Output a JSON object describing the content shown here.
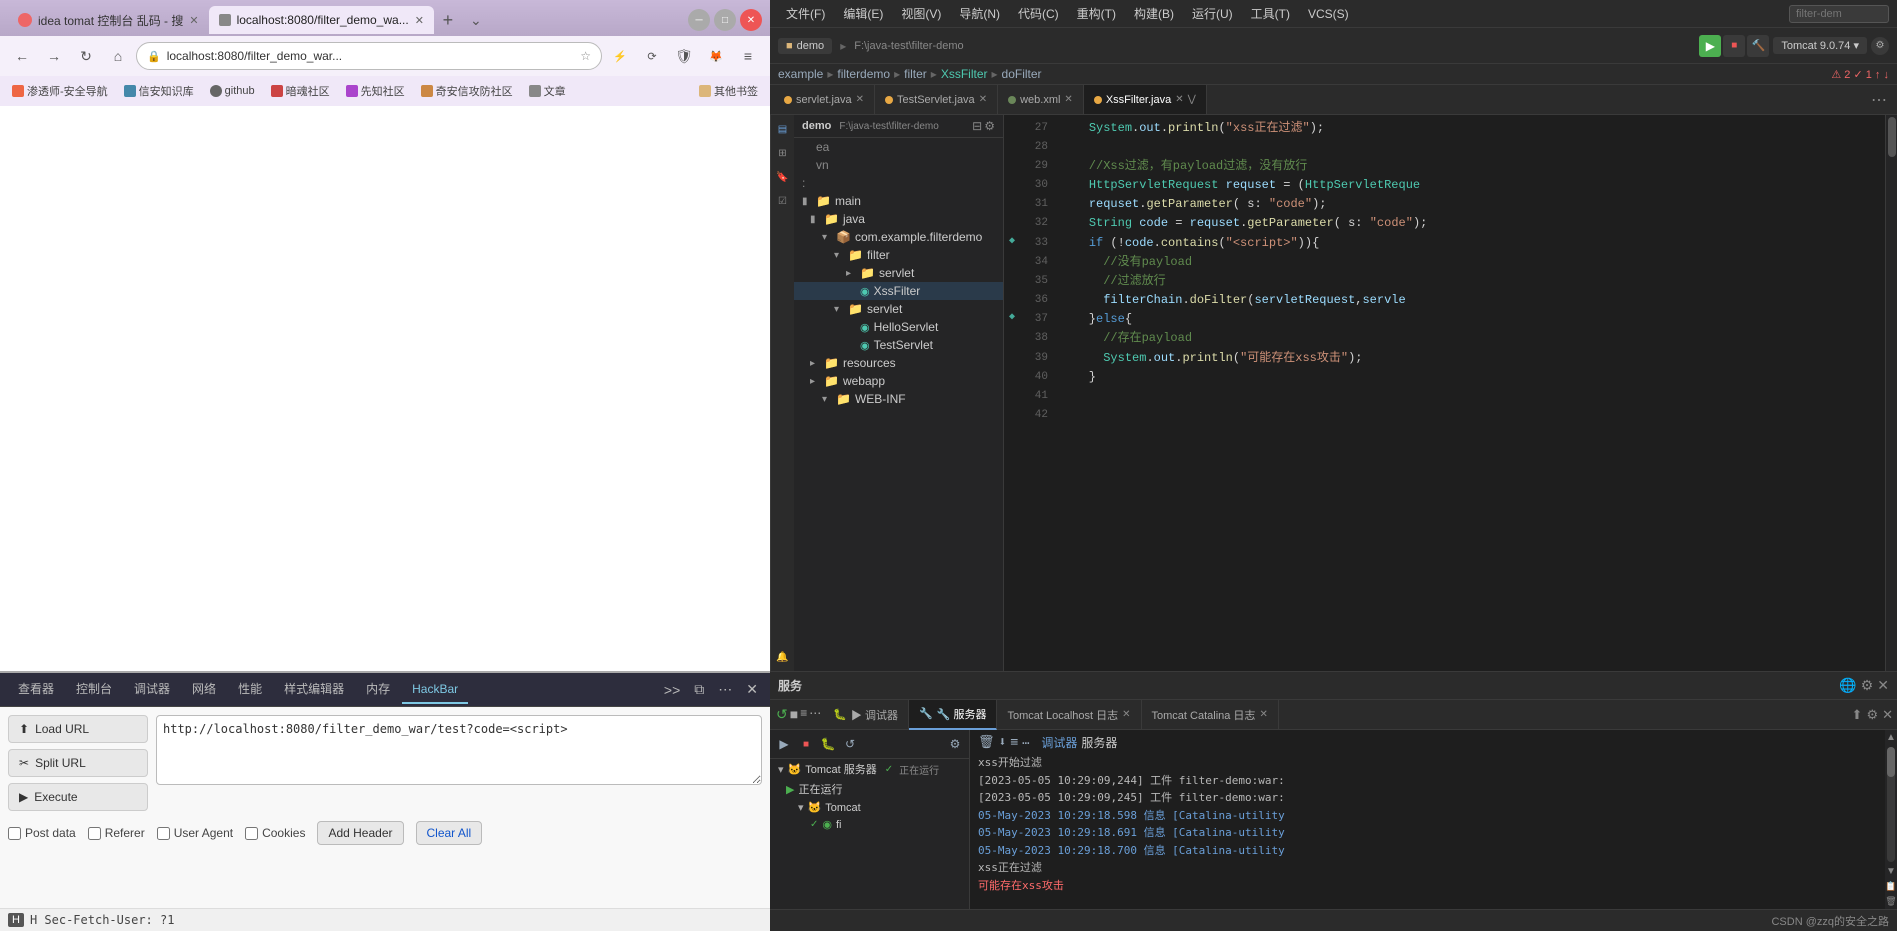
{
  "browser": {
    "tabs": [
      {
        "id": "tab1",
        "label": "idea tomat 控制台 乱码 - 搜",
        "active": false
      },
      {
        "id": "tab2",
        "label": "localhost:8080/filter_demo_wa...",
        "active": true
      }
    ],
    "url": "localhost:8080/filter_demo_war...",
    "bookmarks": [
      {
        "label": "渗透师-安全导航"
      },
      {
        "label": "信安知识库"
      },
      {
        "label": "github"
      },
      {
        "label": "暗魂社区"
      },
      {
        "label": "先知社区"
      },
      {
        "label": "奇安信攻防社区"
      },
      {
        "label": "文章"
      },
      {
        "label": "其他书签"
      }
    ]
  },
  "devtools": {
    "tabs": [
      {
        "label": "查看器"
      },
      {
        "label": "控制台"
      },
      {
        "label": "调试器"
      },
      {
        "label": "网络"
      },
      {
        "label": "性能"
      },
      {
        "label": "样式编辑器"
      },
      {
        "label": "内存"
      },
      {
        "label": "HackBar",
        "active": true
      }
    ]
  },
  "hackbar": {
    "load_url_label": "Load URL",
    "split_url_label": "Split URL",
    "execute_label": "Execute",
    "url_value": "http://localhost:8080/filter_demo_war/test?code=<script>",
    "url_placeholder": "http://localhost:8080/filter_demo_war/test?code=<script>",
    "post_data_label": "Post data",
    "referer_label": "Referer",
    "user_agent_label": "User Agent",
    "cookies_label": "Cookies",
    "add_header_label": "Add Header",
    "clear_all_label": "Clear All",
    "status_bar_text": "H   Sec-Fetch-User: ?1"
  },
  "ide": {
    "menubar": [
      "文件(F)",
      "编辑(E)",
      "视图(V)",
      "导航(N)",
      "代码(C)",
      "重构(T)",
      "构建(B)",
      "运行(U)",
      "工具(T)",
      "VCS(S)"
    ],
    "search_placeholder": "filter-dem",
    "breadcrumb": [
      "example",
      "filterdemo",
      "filter",
      "XssFilter",
      "doFilter"
    ],
    "tabs": [
      {
        "label": "servlet.java",
        "active": false,
        "type": "java"
      },
      {
        "label": "TestServlet.java",
        "active": false,
        "type": "java"
      },
      {
        "label": "web.xml",
        "active": false,
        "type": "xml"
      },
      {
        "label": "XssFilter.java",
        "active": true,
        "type": "java"
      }
    ],
    "project_label": "demo",
    "project_path": "F:\\java-test\\filter-demo",
    "file_tree": [
      {
        "label": "ea",
        "indent": 0,
        "type": "item"
      },
      {
        "label": "vn",
        "indent": 0,
        "type": "item"
      },
      {
        "label": ":",
        "indent": 0,
        "type": "item"
      },
      {
        "label": "main",
        "indent": 0,
        "type": "folder",
        "expanded": true
      },
      {
        "label": "java",
        "indent": 1,
        "type": "folder",
        "expanded": true
      },
      {
        "label": "com.example.filterdemo",
        "indent": 2,
        "type": "folder",
        "expanded": true
      },
      {
        "label": "filter",
        "indent": 3,
        "type": "folder",
        "expanded": true
      },
      {
        "label": "servlet",
        "indent": 4,
        "type": "folder"
      },
      {
        "label": "XssFilter",
        "indent": 4,
        "type": "java"
      },
      {
        "label": "servlet",
        "indent": 3,
        "type": "folder",
        "expanded": true
      },
      {
        "label": "HelloServlet",
        "indent": 4,
        "type": "java"
      },
      {
        "label": "TestServlet",
        "indent": 4,
        "type": "java"
      },
      {
        "label": "resources",
        "indent": 1,
        "type": "folder"
      },
      {
        "label": "webapp",
        "indent": 1,
        "type": "folder"
      },
      {
        "label": "WEB-INF",
        "indent": 2,
        "type": "folder",
        "expanded": false
      }
    ],
    "code_lines": [
      {
        "num": 27,
        "content": "    System.out.println(\"xss正在过滤\");",
        "type": "normal"
      },
      {
        "num": 28,
        "content": ""
      },
      {
        "num": 29,
        "content": "    //Xss过滤，有payload过滤，没有放行",
        "type": "comment"
      },
      {
        "num": 30,
        "content": "    HttpServletRequest requset = (HttpServletReque",
        "type": "normal"
      },
      {
        "num": 31,
        "content": "    requset.getParameter( s: \"code\");",
        "type": "normal"
      },
      {
        "num": 32,
        "content": "    String code = requset.getParameter( s: \"code\");",
        "type": "normal"
      },
      {
        "num": 33,
        "content": "    if (!code.contains(\"<script>\")){",
        "type": "normal"
      },
      {
        "num": 34,
        "content": "      //没有payload",
        "type": "comment"
      },
      {
        "num": 35,
        "content": "      //过滤放行",
        "type": "comment"
      },
      {
        "num": 36,
        "content": "      filterChain.doFilter(servletRequest,servle",
        "type": "normal"
      },
      {
        "num": 37,
        "content": "    }else{",
        "type": "normal"
      },
      {
        "num": 38,
        "content": "      //存在payload",
        "type": "comment"
      },
      {
        "num": 39,
        "content": "      System.out.println(\"可能存在xss攻击\");",
        "type": "normal"
      },
      {
        "num": 40,
        "content": "    }",
        "type": "normal"
      },
      {
        "num": 41,
        "content": ""
      },
      {
        "num": 42,
        "content": ""
      }
    ],
    "bottom_tabs": [
      {
        "label": "▶ 调试器"
      },
      {
        "label": "🔧 服务器",
        "active": true
      },
      {
        "label": "Tomcat Localhost 日志"
      },
      {
        "label": "Tomcat Catalina 日志"
      }
    ],
    "services_label": "服务",
    "tomcat_label": "Tomcat 服务器",
    "running_label": "正在运行",
    "tomcat_instance": "Tomcat",
    "tomcat_filter": "fi",
    "console_lines": [
      {
        "text": "xss开始过滤",
        "type": "normal"
      },
      {
        "text": "[2023-05-05 10:29:09,244] 工件 filter-demo:war:",
        "type": "normal"
      },
      {
        "text": "[2023-05-05 10:29:09,245] 工件 filter-demo:war:",
        "type": "normal"
      },
      {
        "text": "05-May-2023 10:29:18.598 信息 [Catalina-utility",
        "type": "info"
      },
      {
        "text": "05-May-2023 10:29:18.691 信息 [Catalina-utility",
        "type": "info"
      },
      {
        "text": "05-May-2023 10:29:18.700 信息 [Catalina-utility",
        "type": "info"
      },
      {
        "text": "xss正在过滤",
        "type": "normal"
      },
      {
        "text": "可能存在xss攻击",
        "type": "red"
      }
    ],
    "csdn_label": "CSDN @zzq的安全之路"
  }
}
